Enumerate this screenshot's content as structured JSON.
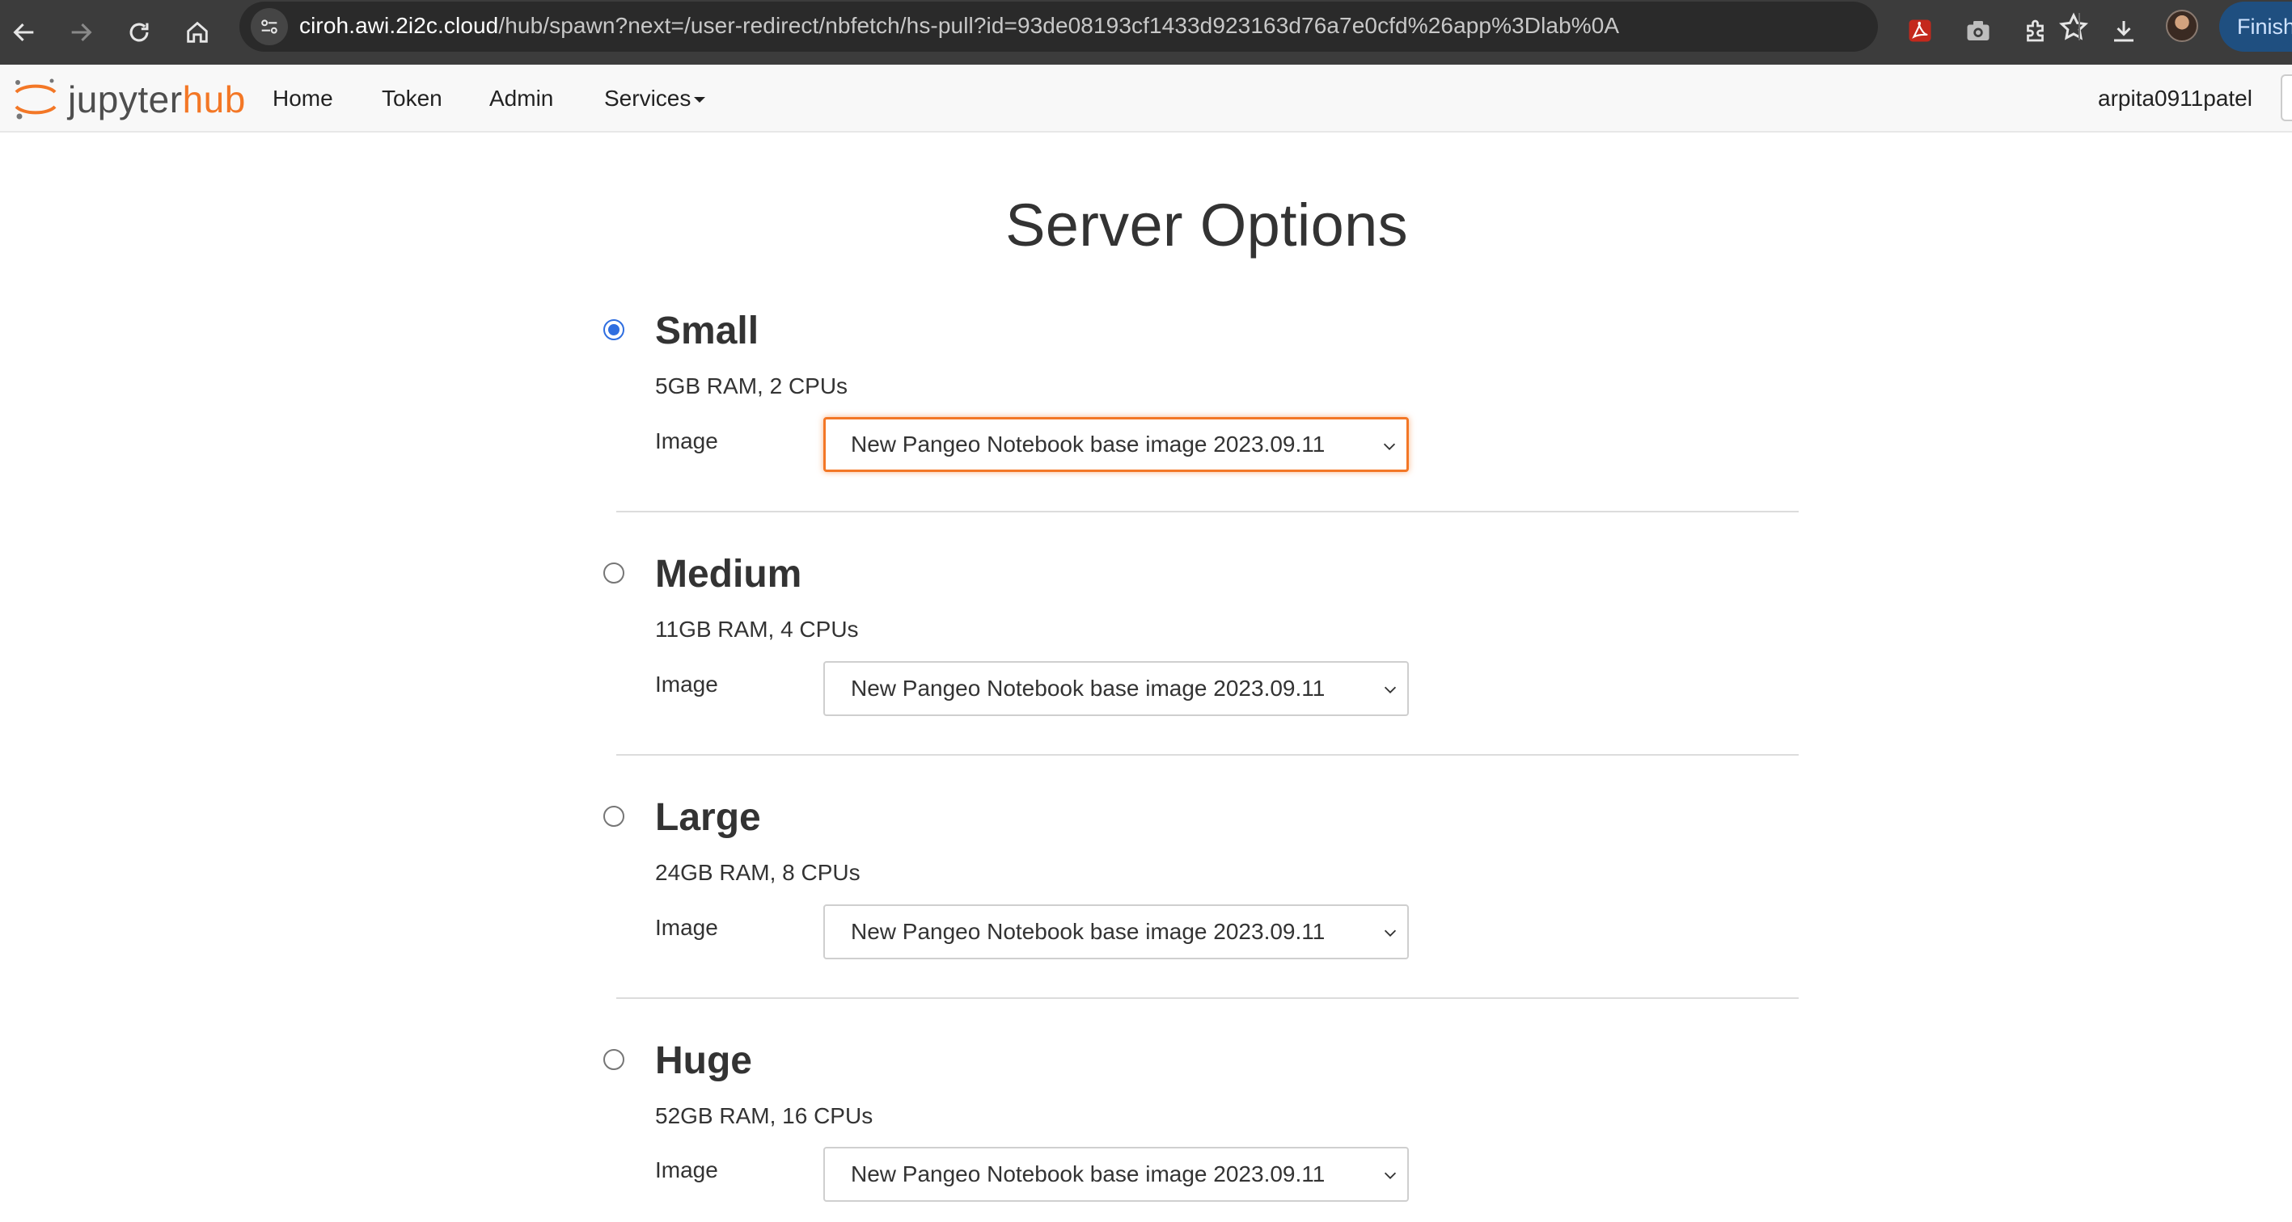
{
  "browser": {
    "url_host": "ciroh.awi.2i2c.cloud",
    "url_path": "/hub/spawn?next=/user-redirect/nbfetch/hs-pull?id=93de08193cf1433d923163d76a7e0cfd%26app%3Dlab%0A",
    "finish_label": "Finish",
    "icons": [
      "back-arrow-icon",
      "forward-arrow-icon",
      "reload-icon",
      "home-icon",
      "site-settings-icon",
      "star-icon",
      "pdf-extension-icon",
      "camera-extension-icon",
      "extensions-puzzle-icon",
      "download-icon"
    ]
  },
  "navbar": {
    "brand_main": "jupyter",
    "brand_accent": "hub",
    "links": [
      "Home",
      "Token",
      "Admin",
      "Services"
    ],
    "username": "arpita0911patel"
  },
  "main": {
    "title": "Server Options",
    "options": [
      {
        "name": "Small",
        "desc": "5GB RAM, 2 CPUs",
        "image_label": "Image",
        "image_value": "New Pangeo Notebook base image 2023.09.11",
        "selected": true
      },
      {
        "name": "Medium",
        "desc": "11GB RAM, 4 CPUs",
        "image_label": "Image",
        "image_value": "New Pangeo Notebook base image 2023.09.11",
        "selected": false
      },
      {
        "name": "Large",
        "desc": "24GB RAM, 8 CPUs",
        "image_label": "Image",
        "image_value": "New Pangeo Notebook base image 2023.09.11",
        "selected": false
      },
      {
        "name": "Huge",
        "desc": "52GB RAM, 16 CPUs",
        "image_label": "Image",
        "image_value": "New Pangeo Notebook base image 2023.09.11",
        "selected": false
      }
    ]
  },
  "colors": {
    "chrome_bg": "#3c3c3c",
    "brand_orange": "#f37726",
    "radio_blue": "#2f6ee0",
    "navbar_bg": "#f8f8f8"
  }
}
